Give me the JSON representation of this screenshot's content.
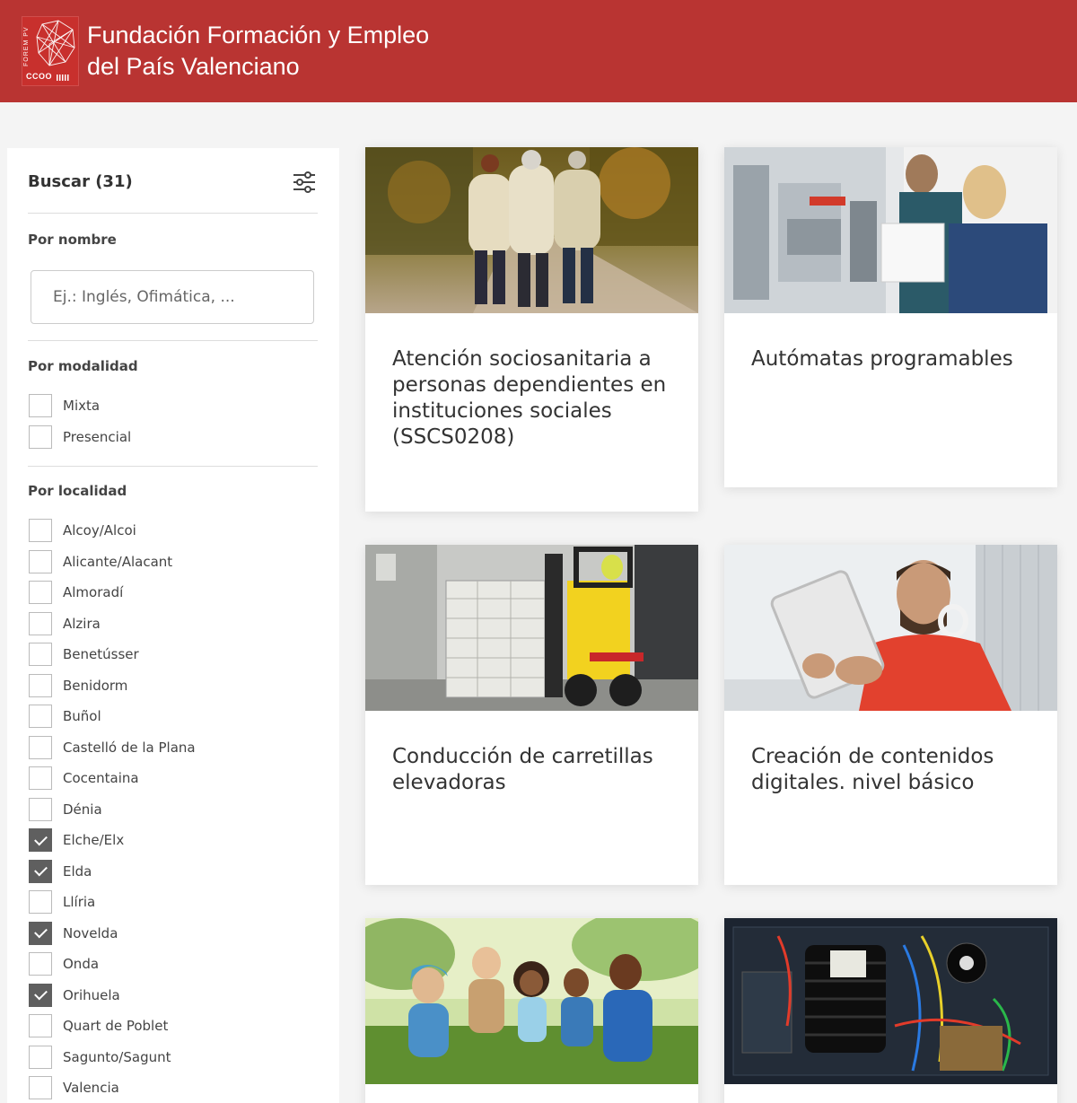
{
  "header": {
    "logo_vertical_text": "FOREM PV",
    "logo_bottom_text": "CCOO",
    "title_line1": "Fundación Formación y Empleo",
    "title_line2": "del País Valenciano"
  },
  "sidebar": {
    "search_heading": "Buscar (31)",
    "by_name_label": "Por nombre",
    "search_placeholder": "Ej.: Inglés, Ofimática, ...",
    "by_modality_label": "Por modalidad",
    "modalities": [
      {
        "label": "Mixta",
        "checked": false
      },
      {
        "label": "Presencial",
        "checked": false
      }
    ],
    "by_location_label": "Por localidad",
    "locations": [
      {
        "label": "Alcoy/Alcoi",
        "checked": false
      },
      {
        "label": "Alicante/Alacant",
        "checked": false
      },
      {
        "label": "Almoradí",
        "checked": false
      },
      {
        "label": "Alzira",
        "checked": false
      },
      {
        "label": "Benetússer",
        "checked": false
      },
      {
        "label": "Benidorm",
        "checked": false
      },
      {
        "label": "Buñol",
        "checked": false
      },
      {
        "label": "Castelló de la Plana",
        "checked": false
      },
      {
        "label": "Cocentaina",
        "checked": false
      },
      {
        "label": "Dénia",
        "checked": false
      },
      {
        "label": "Elche/Elx",
        "checked": true
      },
      {
        "label": "Elda",
        "checked": true
      },
      {
        "label": "Llíria",
        "checked": false
      },
      {
        "label": "Novelda",
        "checked": true
      },
      {
        "label": "Onda",
        "checked": false
      },
      {
        "label": "Orihuela",
        "checked": true
      },
      {
        "label": "Quart de Poblet",
        "checked": false
      },
      {
        "label": "Sagunto/Sagunt",
        "checked": false
      },
      {
        "label": "Valencia",
        "checked": false
      }
    ]
  },
  "courses": [
    {
      "title": "Atención sociosanitaria a personas dependientes en instituciones sociales (SSCS0208)",
      "image": "elderly-walking-photo"
    },
    {
      "title": "Autómatas programables",
      "image": "engineers-lab-photo"
    },
    {
      "title": "Conducción de carretillas elevadoras",
      "image": "forklift-photo"
    },
    {
      "title": "Creación de contenidos digitales. nivel básico",
      "image": "man-tablet-photo"
    },
    {
      "title": "",
      "image": "children-park-photo"
    },
    {
      "title": "",
      "image": "electronics-photo"
    }
  ],
  "colors": {
    "brand_red": "#b93432",
    "checkbox_checked": "#5f5f5f"
  }
}
